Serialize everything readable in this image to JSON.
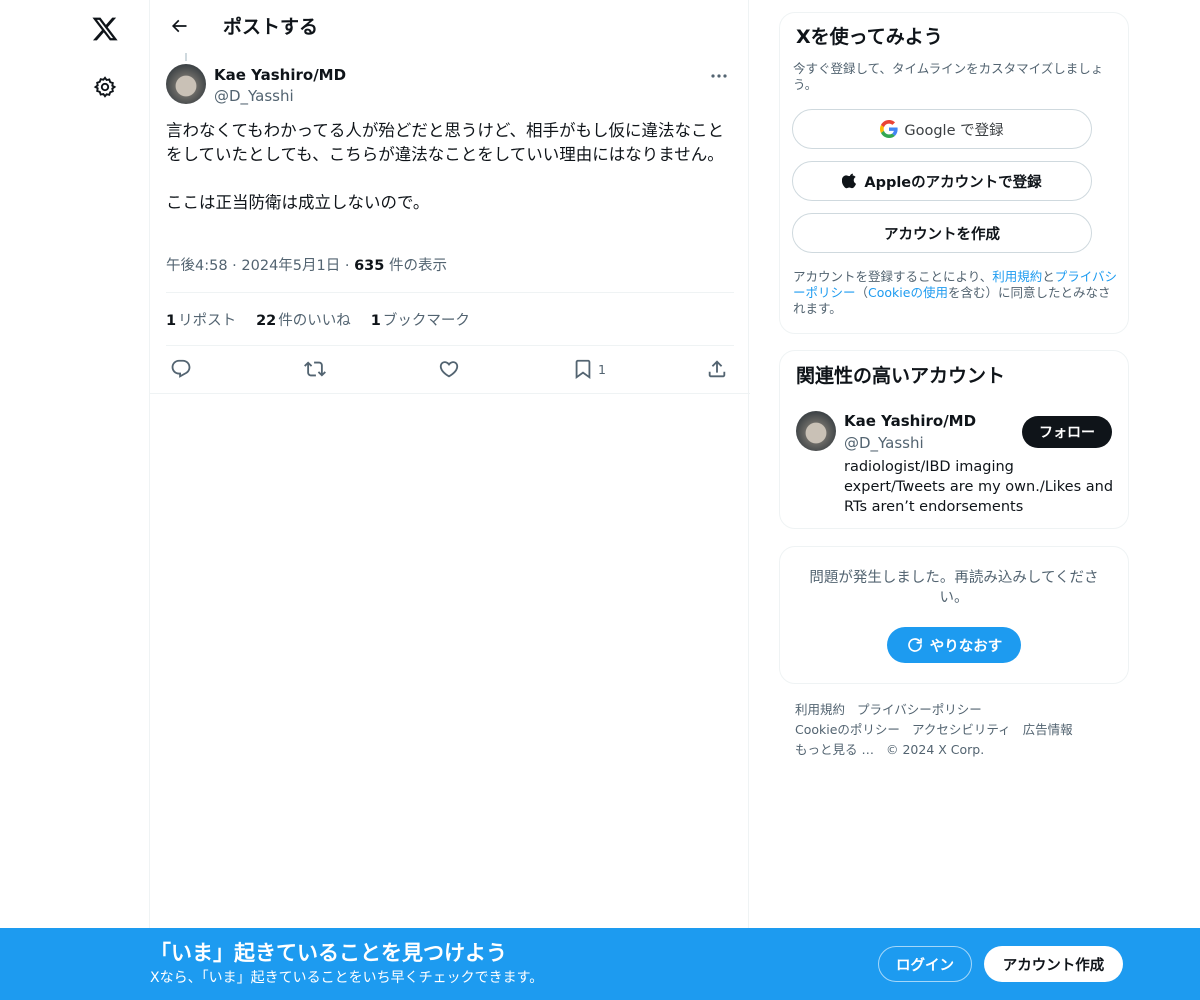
{
  "nav": {
    "logo_icon": "x-logo-icon",
    "settings_icon": "gear-icon"
  },
  "header": {
    "back_icon": "arrow-left-icon",
    "title": "ポストする"
  },
  "post": {
    "author_name": "Kae Yashiro/MD",
    "author_handle": "@D_Yasshi",
    "text": "言わなくてもわかってる人が殆どだと思うけど、相手がもし仮に違法なことをしていたとしても、こちらが違法なことをしていい理由にはなりません。\n\nここは正当防衛は成立しないので。",
    "time": "午後4:58",
    "date": "2024年5月1日",
    "views_count": "635",
    "views_label": " 件の表示",
    "separator": " · ",
    "stats": {
      "reposts_count": "1",
      "reposts_label": "リポスト",
      "likes_count": "22",
      "likes_label": "件のいいね",
      "bookmarks_count": "1",
      "bookmarks_label": "ブックマーク"
    },
    "actions": {
      "bookmark_count": "1"
    }
  },
  "signup_card": {
    "title": "Xを使ってみよう",
    "subtitle": "今すぐ登録して、タイムラインをカスタマイズしましょう。",
    "google_label": "Google で登録",
    "apple_label": "Appleのアカウントで登録",
    "create_label": "アカウントを作成",
    "legal_prefix": "アカウントを登録することにより、",
    "legal_terms": "利用規約",
    "legal_and": "と",
    "legal_privacy": "プライバシーポリシー",
    "legal_paren_open": "（",
    "legal_cookie": "Cookieの使用",
    "legal_suffix": "を含む）に同意したとみなされます。"
  },
  "related_card": {
    "title": "関連性の高いアカウント",
    "name": "Kae Yashiro/MD",
    "handle": "@D_Yasshi",
    "bio": "radiologist/IBD imaging expert/Tweets are my own./Likes and RTs aren’t endorsements",
    "follow_label": "フォロー"
  },
  "error_card": {
    "message": "問題が発生しました。再読み込みしてください。",
    "retry_label": "やりなおす"
  },
  "footer": {
    "terms": "利用規約",
    "privacy": "プライバシーポリシー",
    "cookie": "Cookieのポリシー",
    "accessibility": "アクセシビリティ",
    "ads": "広告情報",
    "more": "もっと見る …",
    "copyright": "© 2024 X Corp."
  },
  "banner": {
    "title": "「いま」起きていることを見つけよう",
    "subtitle": "Xなら、「いま」起きていることをいち早くチェックできます。",
    "login_label": "ログイン",
    "signup_label": "アカウント作成"
  },
  "colors": {
    "accent": "#1d9bf0",
    "text": "#0f1419",
    "muted": "#536471",
    "border": "#eff3f4"
  }
}
